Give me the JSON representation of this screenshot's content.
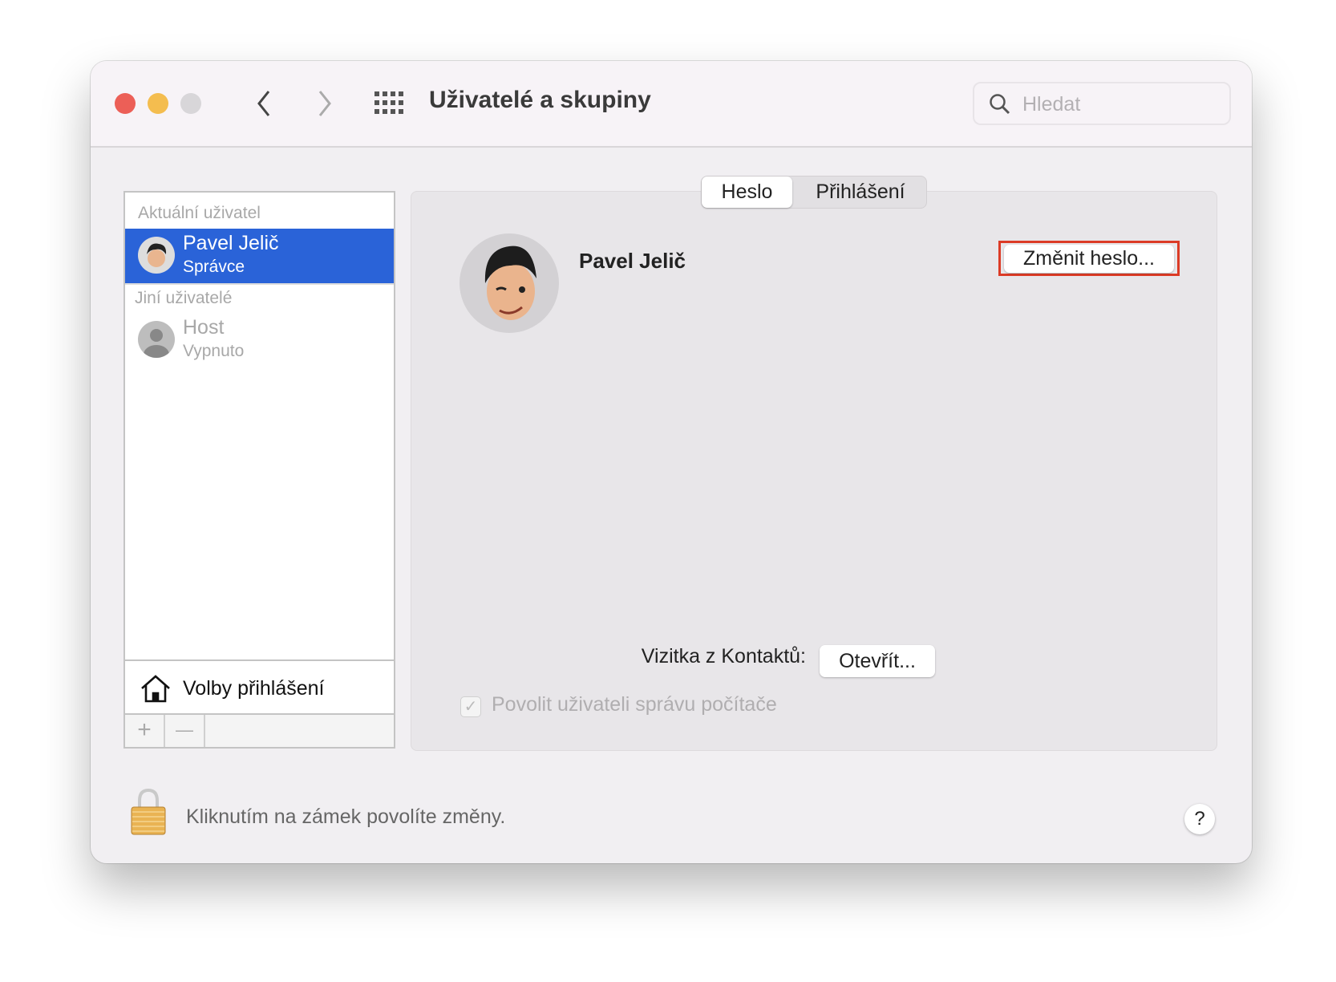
{
  "window": {
    "title": "Uživatelé a skupiny",
    "search_placeholder": "Hledat"
  },
  "colors": {
    "close": "#ec5f57",
    "minimize": "#f4bd4f",
    "zoom": "#d8d6d9",
    "selection": "#2a63d8",
    "highlight": "#dc3b26"
  },
  "sidebar": {
    "current_header": "Aktuální uživatel",
    "current_user": {
      "name": "Pavel Jelič",
      "role": "Správce"
    },
    "others_header": "Jiní uživatelé",
    "other_users": [
      {
        "name": "Host",
        "status": "Vypnuto"
      }
    ],
    "login_options": "Volby přihlášení",
    "add": "+",
    "remove": "—"
  },
  "main": {
    "tabs": [
      {
        "label": "Heslo",
        "selected": true
      },
      {
        "label": "Přihlášení",
        "selected": false
      }
    ],
    "user_name": "Pavel Jelič",
    "change_password": "Změnit heslo...",
    "contact_label": "Vizitka z Kontaktů:",
    "open_button": "Otevřít...",
    "admin_checkbox": {
      "label": "Povolit uživateli správu počítače",
      "checked": true,
      "check": "✓"
    }
  },
  "footer": {
    "lock_text": "Kliknutím na zámek povolíte změny.",
    "help": "?"
  }
}
